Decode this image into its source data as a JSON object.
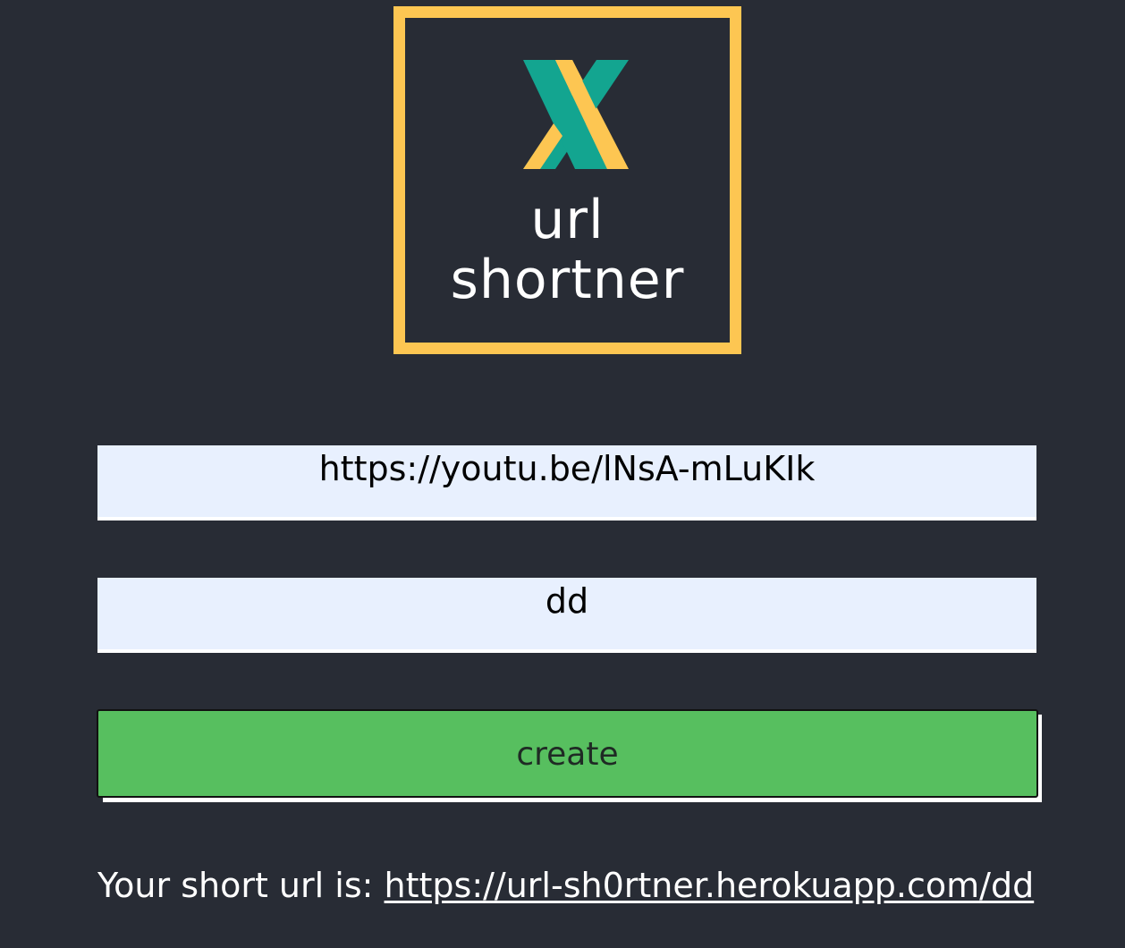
{
  "logo": {
    "line1": "url",
    "line2": "shortner",
    "icon": "x-logo-icon",
    "colors": {
      "frame": "#fdc652",
      "teal": "#13a590",
      "yellow": "#fdc652"
    }
  },
  "form": {
    "url_value": "https://youtu.be/lNsA-mLuKIk",
    "slug_value": "dd",
    "create_label": "create"
  },
  "result": {
    "prefix": "Your short url is: ",
    "link": "https://url-sh0rtner.herokuapp.com/dd"
  },
  "colors": {
    "background": "#282c35",
    "input": "#e8f0fe",
    "button": "#57bf5f"
  }
}
